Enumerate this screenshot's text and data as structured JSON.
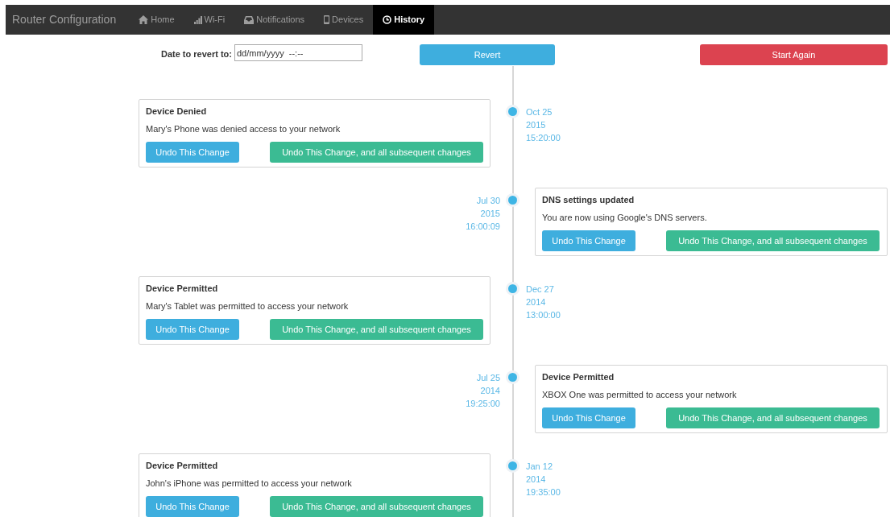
{
  "navbar": {
    "brand": "Router Configuration",
    "items": [
      {
        "label": "Home",
        "selected": false
      },
      {
        "label": "Wi-Fi",
        "selected": false
      },
      {
        "label": "Notifications",
        "selected": false
      },
      {
        "label": "Devices",
        "selected": false
      },
      {
        "label": "History",
        "selected": true
      }
    ]
  },
  "revert_form": {
    "label": "Date to revert to:",
    "placeholder": "dd/mm/yyyy  --:--",
    "revert_button": "Revert",
    "start_again_button": "Start Again"
  },
  "timeline": [
    {
      "title": "Device Denied",
      "text": "Mary's Phone was denied access to your network",
      "date": [
        "Oct 25",
        "2015",
        "15:20:00"
      ],
      "buttons": [
        "Undo This Change",
        "Undo This Change, and all subsequent changes"
      ]
    },
    {
      "title": "DNS settings updated",
      "text": "You are now using Google's DNS servers.",
      "date": [
        "Jul 30",
        "2015",
        "16:00:09"
      ],
      "buttons": [
        "Undo This Change",
        "Undo This Change, and all subsequent changes"
      ]
    },
    {
      "title": "Device Permitted",
      "text": "Mary's Tablet was permitted to access your network",
      "date": [
        "Dec 27",
        "2014",
        "13:00:00"
      ],
      "buttons": [
        "Undo This Change",
        "Undo This Change, and all subsequent changes"
      ]
    },
    {
      "title": "Device Permitted",
      "text": "XBOX One was permitted to access your network",
      "date": [
        "Jul 25",
        "2014",
        "19:25:00"
      ],
      "buttons": [
        "Undo This Change",
        "Undo This Change, and all subsequent changes"
      ]
    },
    {
      "title": "Device Permitted",
      "text": "John's iPhone was permitted to access your network",
      "date": [
        "Jan 12",
        "2014",
        "19:35:00"
      ],
      "buttons": [
        "Undo This Change",
        "Undo This Change, and all subsequent changes"
      ]
    }
  ]
}
